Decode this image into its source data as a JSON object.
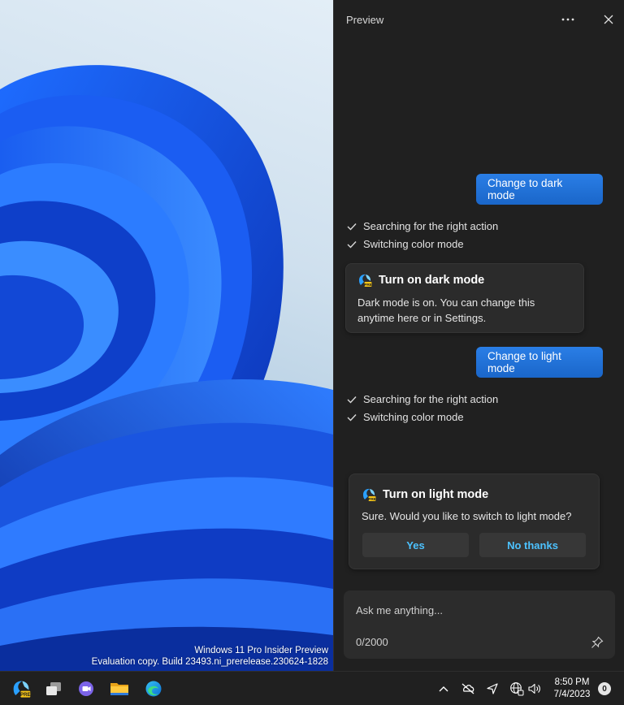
{
  "desktop": {
    "watermark_line1": "Windows 11 Pro Insider Preview",
    "watermark_line2": "Evaluation copy. Build 23493.ni_prerelease.230624-1828"
  },
  "panel": {
    "title": "Preview",
    "more_icon": "more-horizontal-icon",
    "close_icon": "close-icon"
  },
  "conversation": {
    "user_message_1": "Change to dark mode",
    "status_1": [
      "Searching for the right action",
      "Switching color mode"
    ],
    "card_1": {
      "title": "Turn on dark mode",
      "body": "Dark mode is on. You can change this anytime here or in Settings."
    },
    "user_message_2": "Change to light mode",
    "status_2": [
      "Searching for the right action",
      "Switching color mode"
    ],
    "card_2": {
      "title": "Turn on light mode",
      "body": "Sure. Would you like to switch to light mode?",
      "yes_label": "Yes",
      "no_label": "No thanks"
    }
  },
  "composer": {
    "placeholder": "Ask me anything...",
    "char_count": "0/2000",
    "pin_icon": "pin-icon"
  },
  "taskbar": {
    "apps": [
      "copilot-pre-icon",
      "task-view-icon",
      "teams-chat-icon",
      "file-explorer-icon",
      "edge-icon"
    ],
    "tray": [
      "chevron-up-icon",
      "network-off-icon",
      "location-icon",
      "language-globe-icon",
      "volume-icon"
    ],
    "time": "8:50 PM",
    "date": "7/4/2023",
    "notification_count": "0"
  },
  "colors": {
    "accent": "#1f6fd6",
    "link_blue": "#4cc2ff",
    "panel_bg": "#202020",
    "card_bg": "#2b2b2b"
  }
}
